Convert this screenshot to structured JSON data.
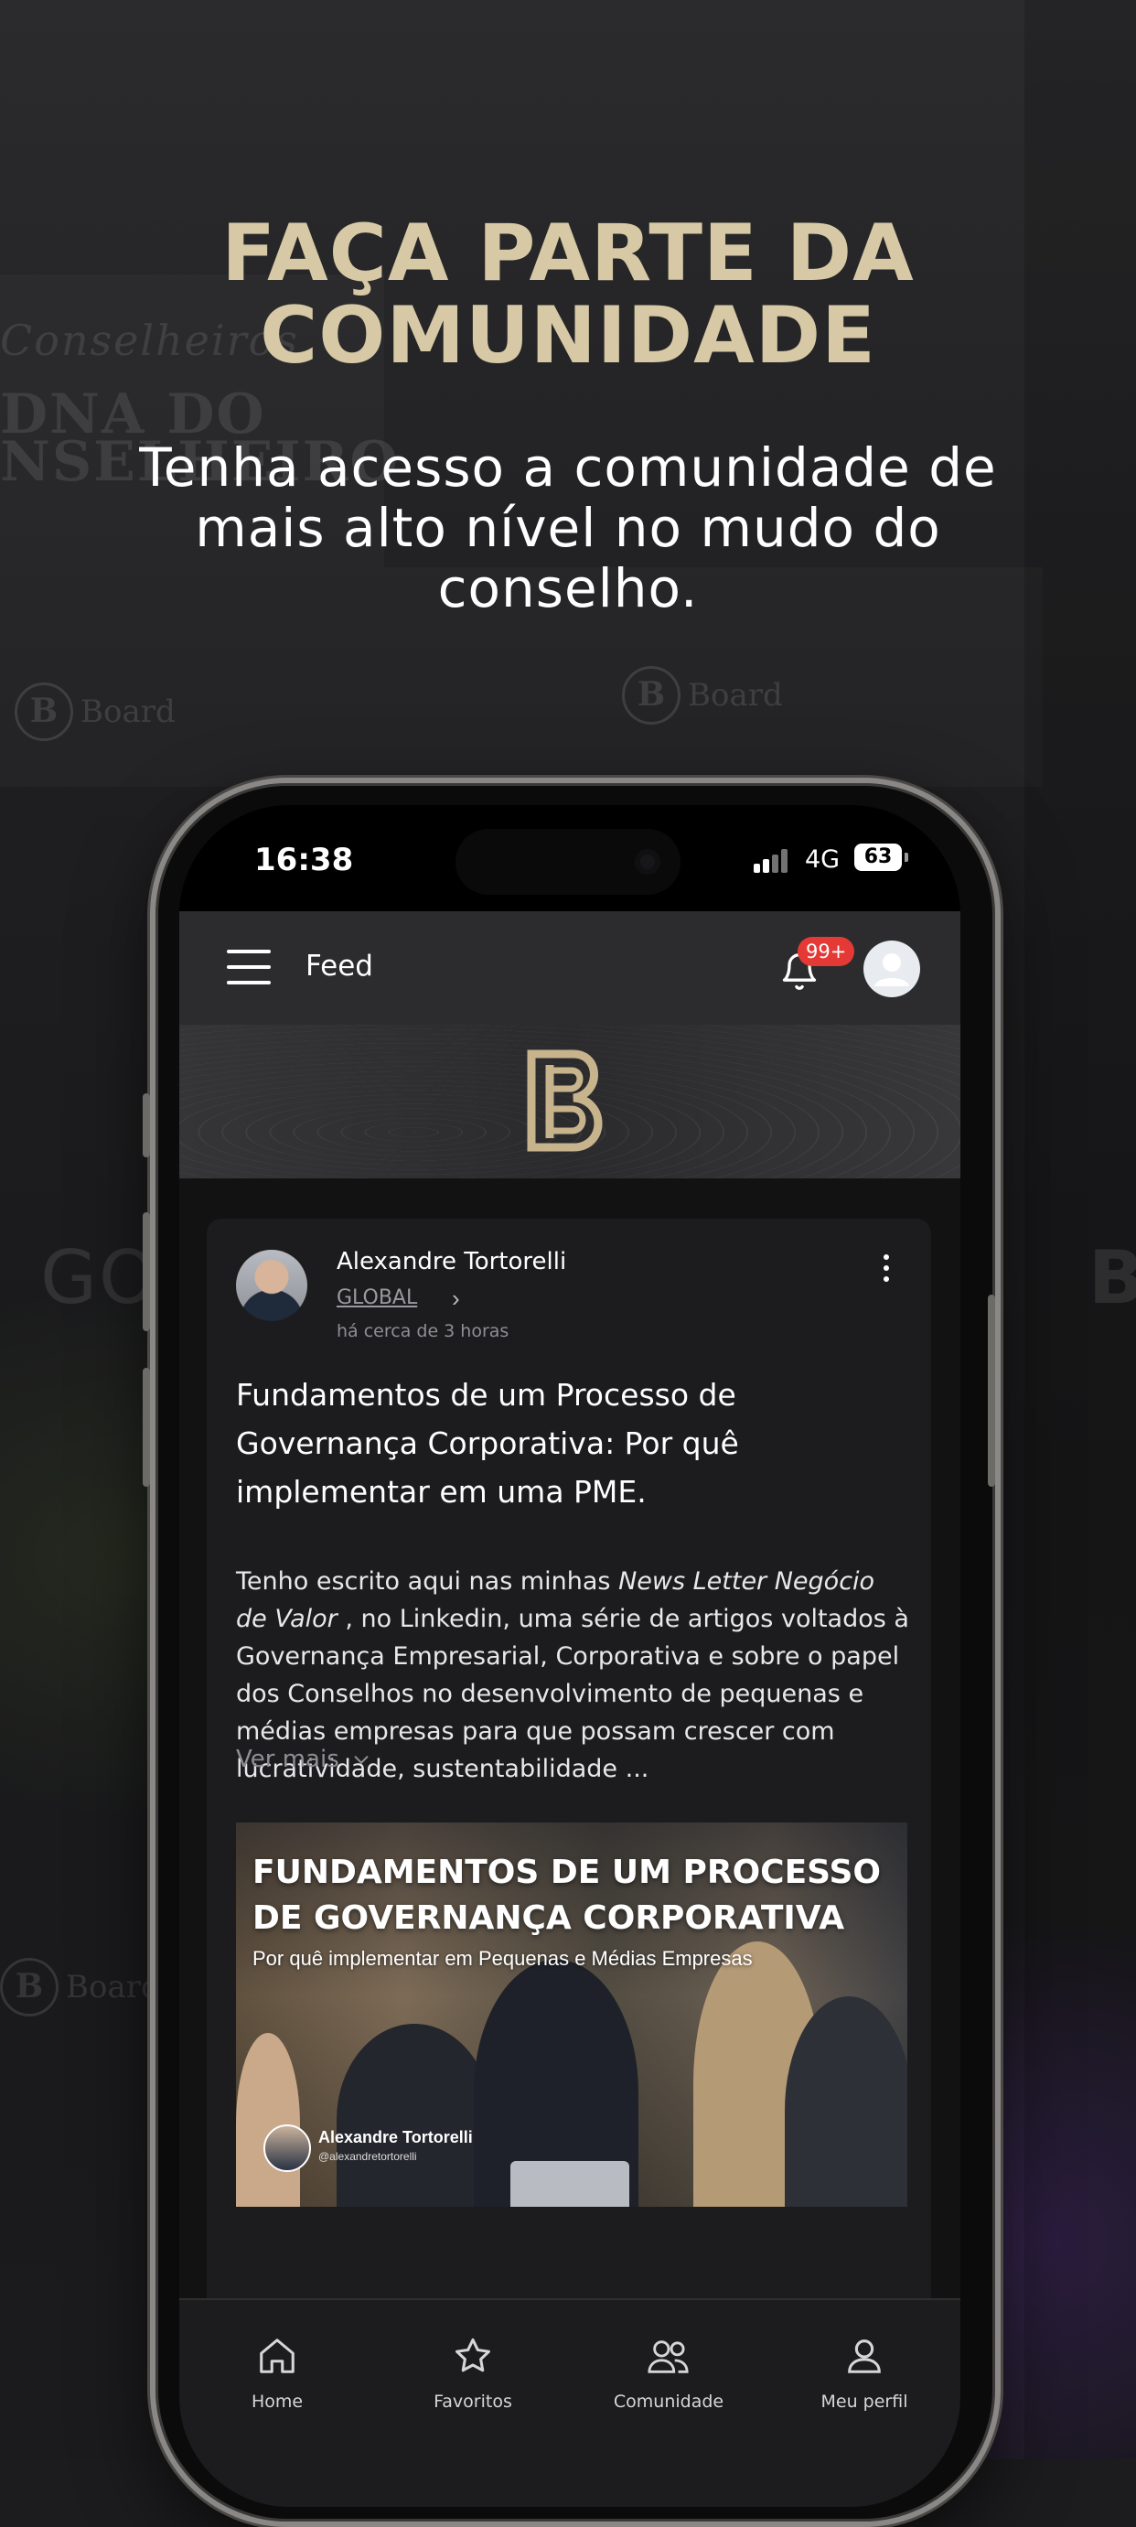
{
  "promo": {
    "headline_line1": "FAÇA PARTE DA",
    "headline_line2": "COMUNIDADE",
    "subheadline": "Tenha acesso a comunidade de mais alto nível no mudo do conselho."
  },
  "background_artwork": {
    "texts": [
      "Conselheiros",
      "DNA DO",
      "NSELHEIRO",
      "Board",
      "Board",
      "GOV",
      "Board",
      "B"
    ],
    "logo_mark": "B"
  },
  "status_bar": {
    "time": "16:38",
    "network": "4G",
    "battery": "63"
  },
  "app_bar": {
    "title": "Feed",
    "notification_badge": "99+",
    "menu_icon": "hamburger-menu-icon",
    "notifications_icon": "bell-icon",
    "profile_icon": "user-avatar-icon"
  },
  "banner": {
    "logo": "B"
  },
  "post": {
    "author": "Alexandre Tortorelli",
    "scope": "GLOBAL",
    "time_ago": "há cerca de 3 horas",
    "title": "Fundamentos de um Processo de Governança Corporativa: Por quê implementar em uma PME.",
    "body_prefix": "Tenho escrito aqui nas minhas ",
    "body_italic": "News Letter Negócio de Valor",
    "body_suffix": " , no Linkedin, uma série de artigos voltados à Governança Empresarial, Corporativa e sobre o papel dos Conselhos no desenvolvimento de pequenas e médias empresas para que possam crescer com lucratividade, sustentabilidade ...",
    "see_more": "Ver mais",
    "image": {
      "title_line1": "FUNDAMENTOS DE UM PROCESSO",
      "title_line2": "DE GOVERNANÇA CORPORATIVA",
      "subtitle": "Por quê implementar em Pequenas e Médias Empresas",
      "author": "Alexandre Tortorelli",
      "handle": "@alexandretortorelli"
    }
  },
  "tab_bar": {
    "items": [
      {
        "label": "Home",
        "icon": "home-icon"
      },
      {
        "label": "Favoritos",
        "icon": "star-icon"
      },
      {
        "label": "Comunidade",
        "icon": "community-icon"
      },
      {
        "label": "Meu perfil",
        "icon": "profile-icon"
      }
    ]
  },
  "colors": {
    "headline": "#d7c9a6",
    "app_bar": "#2c2c2e",
    "badge": "#e53935",
    "card": "#1c1c1e"
  }
}
